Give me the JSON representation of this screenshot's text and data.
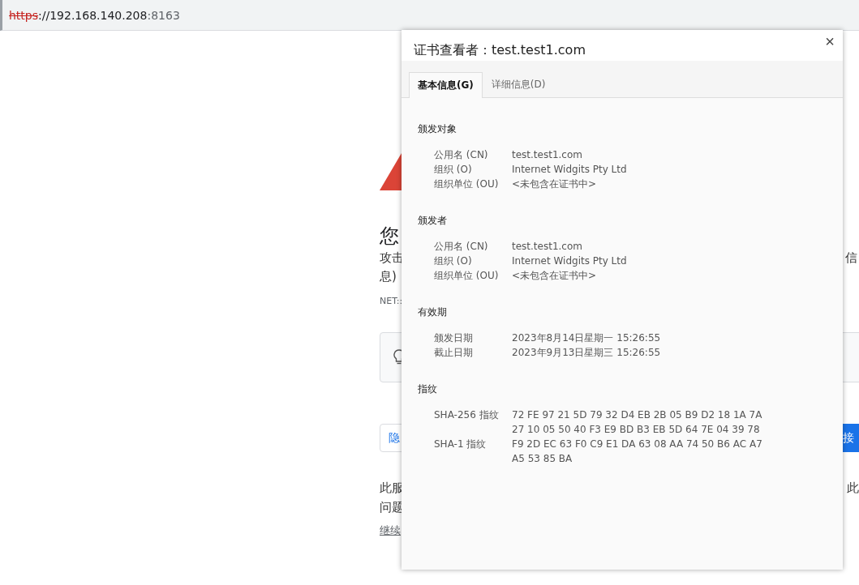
{
  "address_bar": {
    "scheme": "https",
    "rest": "://192.168.140.208",
    "port": ":8163"
  },
  "page": {
    "heading": "您",
    "paragraph_lines": [
      {
        "left": "攻击",
        "right": "信"
      },
      {
        "left": "息)"
      }
    ],
    "error_code": "NET::",
    "input_text": "隐",
    "action_button": "接",
    "note_lines": [
      {
        "left": "此服",
        "right": "此"
      },
      {
        "left": "问题"
      }
    ],
    "link": "继续"
  },
  "dialog": {
    "title": "证书查看者：test.test1.com",
    "close": "×",
    "tabs": [
      {
        "label": "基本信息(G)",
        "selected": true
      },
      {
        "label": "详细信息(D)",
        "selected": false
      }
    ],
    "sections": [
      {
        "heading": "颁发对象",
        "fields": [
          {
            "label": "公用名 (CN)",
            "lines": [
              "test.test1.com"
            ]
          },
          {
            "label": "组织 (O)",
            "lines": [
              "Internet Widgits Pty Ltd"
            ]
          },
          {
            "label": "组织单位 (OU)",
            "lines": [
              "<未包含在证书中>"
            ]
          }
        ]
      },
      {
        "heading": "颁发者",
        "fields": [
          {
            "label": "公用名 (CN)",
            "lines": [
              "test.test1.com"
            ]
          },
          {
            "label": "组织 (O)",
            "lines": [
              "Internet Widgits Pty Ltd"
            ]
          },
          {
            "label": "组织单位 (OU)",
            "lines": [
              "<未包含在证书中>"
            ]
          }
        ]
      },
      {
        "heading": "有效期",
        "fields": [
          {
            "label": "颁发日期",
            "lines": [
              "2023年8月14日星期一 15:26:55"
            ]
          },
          {
            "label": "截止日期",
            "lines": [
              "2023年9月13日星期三 15:26:55"
            ]
          }
        ]
      },
      {
        "heading": "指纹",
        "fields": [
          {
            "label": "SHA-256 指纹",
            "lines": [
              "72 FE 97 21 5D 79 32 D4 EB 2B 05 B9 D2 18 1A 7A",
              "27 10 05 50 40 F3 E9 BD B3 EB 5D 64 7E 04 39 78"
            ]
          },
          {
            "label": "SHA-1 指纹",
            "lines": [
              "F9 2D EC 63 F0 C9 E1 DA 63 08 AA 74 50 B6 AC A7",
              "A5 53 85 BA"
            ]
          }
        ]
      }
    ]
  }
}
